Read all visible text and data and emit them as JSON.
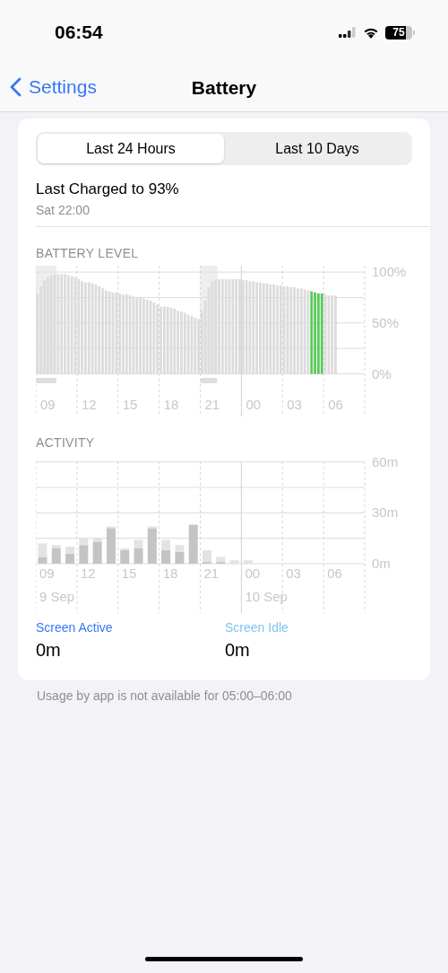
{
  "status_bar": {
    "time": "06:54",
    "battery_percent": "75"
  },
  "nav": {
    "back": "Settings",
    "title": "Battery"
  },
  "tabs": [
    {
      "label": "Last 24 Hours",
      "selected": true
    },
    {
      "label": "Last 10 Days",
      "selected": false
    }
  ],
  "last_charged": {
    "title": "Last Charged to 93%",
    "time": "Sat 22:00"
  },
  "battery_level": {
    "label": "BATTERY LEVEL",
    "chart_data": {
      "type": "bar",
      "grid": true,
      "categories": [
        null,
        null,
        null,
        "09",
        null,
        null,
        null,
        null,
        null,
        null,
        null,
        null,
        null,
        null,
        null,
        "12",
        null,
        null,
        null,
        null,
        null,
        null,
        null,
        null,
        null,
        null,
        null,
        "15",
        null,
        null,
        null,
        null,
        null,
        null,
        null,
        null,
        null,
        null,
        null,
        "18",
        null,
        null,
        null,
        null,
        null,
        null,
        null,
        null,
        null,
        null,
        null,
        "21",
        null,
        null,
        null,
        null,
        null,
        null,
        null,
        null,
        null,
        null,
        null,
        "00",
        null,
        null,
        null,
        null,
        null,
        null,
        null,
        null,
        null,
        null,
        null,
        "03",
        null,
        null,
        null,
        null,
        null,
        null,
        null,
        null,
        null,
        null,
        null,
        "06",
        null,
        null,
        null,
        null,
        null,
        null,
        null,
        null
      ],
      "series": [
        {
          "color": "#dcdcdc",
          "values": [
            78,
            86,
            92,
            95,
            97,
            98,
            98,
            98,
            98,
            97,
            96,
            95,
            93,
            91,
            90,
            90,
            89,
            88,
            86,
            84,
            82,
            81,
            80,
            80,
            79,
            78,
            78,
            77,
            76,
            75,
            75,
            74,
            73,
            72,
            70,
            68,
            66,
            66,
            66,
            65,
            64,
            62,
            61,
            60,
            58,
            57,
            55,
            54,
            62,
            72,
            85,
            91,
            93,
            93,
            93,
            93,
            93,
            93,
            93,
            93,
            92,
            92,
            91,
            91,
            90,
            90,
            89,
            89,
            88,
            88,
            87,
            87,
            86,
            86,
            85,
            85,
            84,
            84,
            83,
            82,
            null,
            null,
            null,
            null,
            78,
            77,
            77,
            77,
            null,
            null,
            null,
            null,
            null,
            null,
            null,
            null
          ]
        },
        {
          "color": "#5ac85a",
          "values": [
            null,
            null,
            null,
            null,
            null,
            null,
            null,
            null,
            null,
            null,
            null,
            null,
            null,
            null,
            null,
            null,
            null,
            null,
            null,
            null,
            null,
            null,
            null,
            null,
            null,
            null,
            null,
            null,
            null,
            null,
            null,
            null,
            null,
            null,
            null,
            null,
            null,
            null,
            null,
            null,
            null,
            null,
            null,
            null,
            null,
            null,
            null,
            null,
            null,
            null,
            null,
            null,
            null,
            null,
            null,
            null,
            null,
            null,
            null,
            null,
            null,
            null,
            null,
            null,
            null,
            null,
            null,
            null,
            null,
            null,
            null,
            null,
            null,
            null,
            null,
            null,
            null,
            null,
            null,
            null,
            81,
            80,
            79,
            79,
            null,
            null,
            null,
            null,
            null,
            null,
            null,
            null,
            null,
            null,
            null,
            null
          ]
        }
      ],
      "ylim": [
        0,
        100
      ],
      "yticks": [
        {
          "value": 100,
          "label": "100%"
        },
        {
          "value": 50,
          "label": "50%"
        },
        {
          "value": 0,
          "label": "0%"
        }
      ]
    }
  },
  "activity": {
    "label": "ACTIVITY",
    "chart_data": {
      "type": "bar",
      "stacked": true,
      "grid": true,
      "categories": [
        "09",
        null,
        null,
        "12",
        null,
        null,
        "15",
        null,
        null,
        "18",
        null,
        null,
        "21",
        null,
        null,
        "00",
        null,
        null,
        "03",
        null,
        null,
        "06",
        null,
        null
      ],
      "series": [
        {
          "color": "#c4c4c4",
          "values": [
            4,
            9,
            6,
            11,
            13,
            21,
            8,
            9,
            21,
            8,
            7,
            23,
            1,
            1,
            0,
            0,
            null,
            null,
            null,
            null,
            null,
            null,
            null,
            null
          ]
        },
        {
          "color": "#e3e3e3",
          "values": [
            8,
            2,
            4,
            4,
            2,
            1,
            1,
            5,
            1,
            6,
            4,
            0,
            7,
            3,
            2,
            2,
            null,
            null,
            null,
            null,
            null,
            null,
            null,
            null
          ]
        }
      ],
      "ylim": [
        0,
        60
      ],
      "yticks": [
        {
          "value": 60,
          "label": "60m"
        },
        {
          "value": 30,
          "label": "30m"
        },
        {
          "value": 0,
          "label": "0m"
        }
      ]
    },
    "date_labels": [
      "9 Sep",
      "10 Sep"
    ]
  },
  "legend": [
    {
      "label": "Screen Active",
      "value": "0m",
      "color": "#3478f6"
    },
    {
      "label": "Screen Idle",
      "value": "0m",
      "color": "#7cc4f5"
    }
  ],
  "footer": "Usage by app is not available for 05:00–06:00"
}
